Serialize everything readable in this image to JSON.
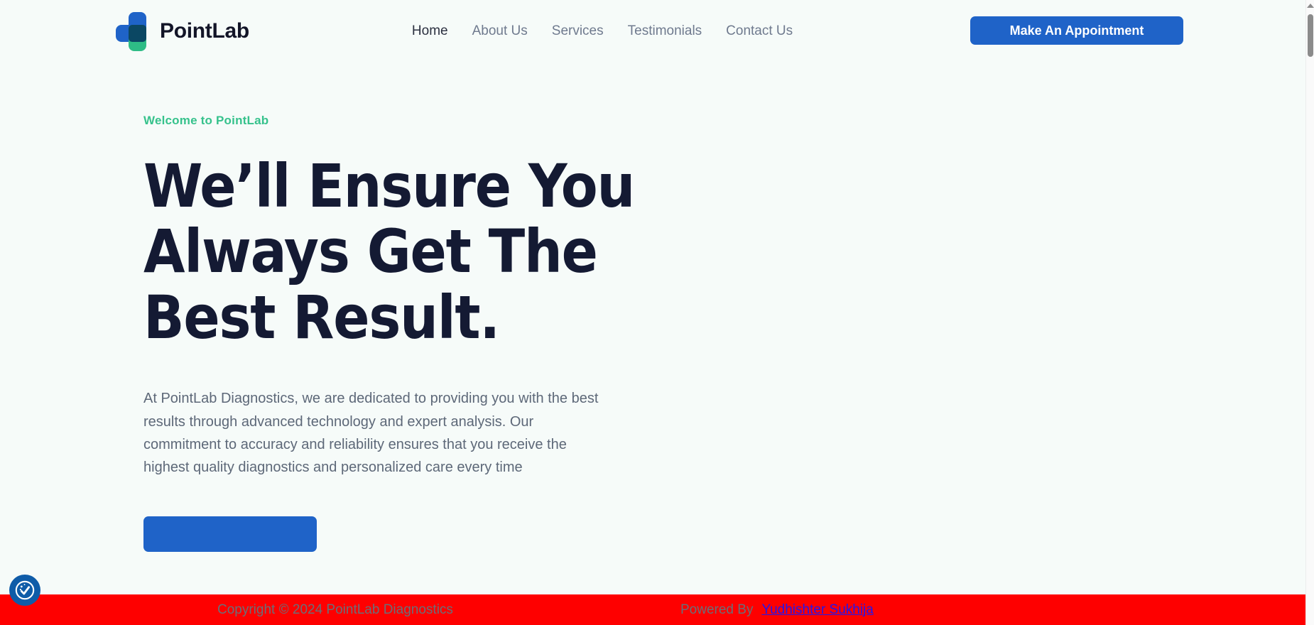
{
  "brand": {
    "name": "PointLab",
    "logo_icon": "medical-cross-icon",
    "colors": {
      "blue": "#1f63c8",
      "green": "#2ebc86",
      "overlap": "#0b4763"
    }
  },
  "nav": {
    "items": [
      {
        "label": "Home",
        "active": true
      },
      {
        "label": "About Us",
        "active": false
      },
      {
        "label": "Services",
        "active": false
      },
      {
        "label": "Testimonials",
        "active": false
      },
      {
        "label": "Contact Us",
        "active": false
      }
    ],
    "cta_label": "Make An Appointment"
  },
  "hero": {
    "eyebrow": "Welcome to PointLab",
    "eyebrow_color": "#36c28c",
    "title_lines": [
      "We’ll Ensure You",
      "Always Get The",
      "Best Result."
    ],
    "description": "At PointLab Diagnostics, we are dedicated to providing you with the best results through advanced technology and expert analysis. Our commitment to accuracy and reliability ensures that you receive the highest quality diagnostics and personalized care every time",
    "button_label": ""
  },
  "cookie_widget": {
    "icon": "cookie-consent-icon",
    "color": "#0f5ca8"
  },
  "footer": {
    "background": "#fe0000",
    "copyright": "Copyright © 2024 PointLab Diagnostics",
    "powered_by_label": "Powered By",
    "author": "Yudhishter Sukhija",
    "author_color": "#2017ef"
  },
  "scrollbar": {
    "position": "right",
    "thumb_color": "#8b8b8b"
  }
}
